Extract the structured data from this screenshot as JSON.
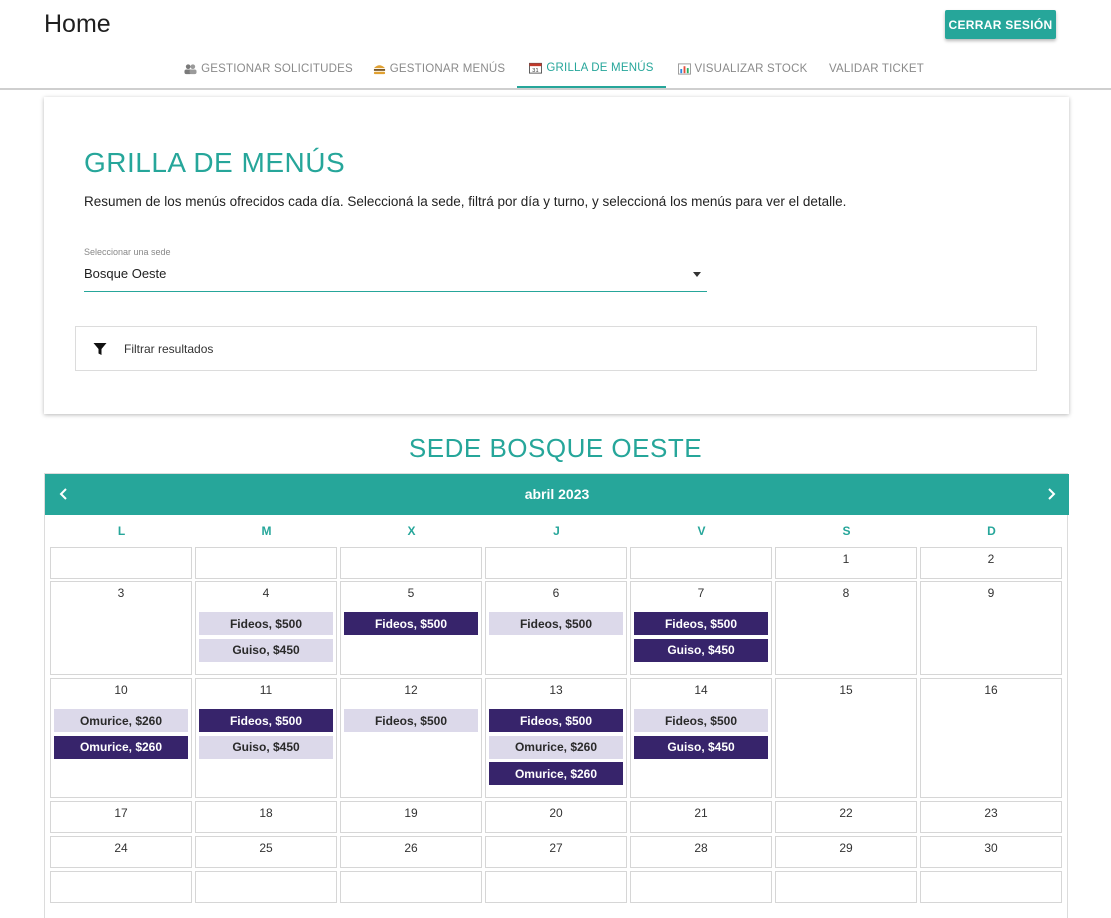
{
  "header": {
    "title": "Home",
    "logout_label": "CERRAR SESIÓN"
  },
  "tabs": [
    {
      "label": "GESTIONAR SOLICITUDES",
      "icon": "people-icon",
      "active": false
    },
    {
      "label": "GESTIONAR MENÚS",
      "icon": "burger-icon",
      "active": false
    },
    {
      "label": "GRILLA DE MENÚS",
      "icon": "calendar-icon",
      "active": true
    },
    {
      "label": "VISUALIZAR STOCK",
      "icon": "bar-chart-icon",
      "active": false
    },
    {
      "label": "VALIDAR TICKET",
      "icon": "",
      "active": false
    }
  ],
  "card": {
    "title": "GRILLA DE MENÚS",
    "description": "Resumen de los menús ofrecidos cada día. Seleccioná la sede, filtrá por día y turno, y seleccioná los menús para ver el detalle.",
    "select_label": "Seleccionar una sede",
    "select_value": "Bosque Oeste",
    "filter_label": "Filtrar resultados"
  },
  "calendar": {
    "sede_title": "SEDE BOSQUE OESTE",
    "month_label": "abril 2023",
    "weekdays": [
      "L",
      "M",
      "X",
      "J",
      "V",
      "S",
      "D"
    ],
    "weeks": [
      [
        "",
        "",
        "",
        "",
        "",
        "1",
        "2"
      ],
      [
        "3",
        "4",
        "5",
        "6",
        "7",
        "8",
        "9"
      ],
      [
        "10",
        "11",
        "12",
        "13",
        "14",
        "15",
        "16"
      ],
      [
        "17",
        "18",
        "19",
        "20",
        "21",
        "22",
        "23"
      ],
      [
        "24",
        "25",
        "26",
        "27",
        "28",
        "29",
        "30"
      ],
      [
        "",
        "",
        "",
        "",
        "",
        "",
        ""
      ]
    ],
    "menus": {
      "4": [
        {
          "label": "Fideos, $500",
          "style": "light"
        },
        {
          "label": "Guiso, $450",
          "style": "light"
        }
      ],
      "5": [
        {
          "label": "Fideos, $500",
          "style": "dark"
        }
      ],
      "6": [
        {
          "label": "Fideos, $500",
          "style": "light"
        }
      ],
      "7": [
        {
          "label": "Fideos, $500",
          "style": "dark"
        },
        {
          "label": "Guiso, $450",
          "style": "dark"
        }
      ],
      "10": [
        {
          "label": "Omurice, $260",
          "style": "light"
        },
        {
          "label": "Omurice, $260",
          "style": "dark"
        }
      ],
      "11": [
        {
          "label": "Fideos, $500",
          "style": "dark"
        },
        {
          "label": "Guiso, $450",
          "style": "light"
        }
      ],
      "12": [
        {
          "label": "Fideos, $500",
          "style": "light"
        }
      ],
      "13": [
        {
          "label": "Fideos, $500",
          "style": "dark"
        },
        {
          "label": "Omurice, $260",
          "style": "light"
        },
        {
          "label": "Omurice, $260",
          "style": "dark"
        }
      ],
      "14": [
        {
          "label": "Fideos, $500",
          "style": "light"
        },
        {
          "label": "Guiso, $450",
          "style": "dark"
        }
      ]
    }
  },
  "colors": {
    "accent": "#26a69a",
    "chip_light": "#dcd9ea",
    "chip_dark": "#37246b"
  }
}
